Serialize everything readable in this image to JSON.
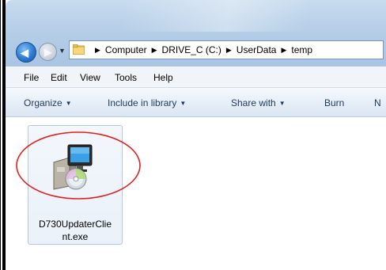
{
  "window": {
    "address_path": [
      "Computer",
      "DRIVE_C (C:)",
      "UserData",
      "temp"
    ]
  },
  "menubar": {
    "items": [
      "File",
      "Edit",
      "View",
      "Tools",
      "Help"
    ]
  },
  "command_bar": {
    "organize": "Organize",
    "include_in_library": "Include in library",
    "share_with": "Share with",
    "burn": "Burn",
    "overflow": "N"
  },
  "files": [
    {
      "name": "D730UpdaterClient.exe",
      "display_line1": "D730UpdaterClie",
      "display_line2": "nt.exe",
      "icon": "installer-exe-icon"
    }
  ],
  "colors": {
    "highlight_circle": "#e02020",
    "titlebar": "#b7cfe8",
    "selection_border": "#b3c9e3"
  }
}
